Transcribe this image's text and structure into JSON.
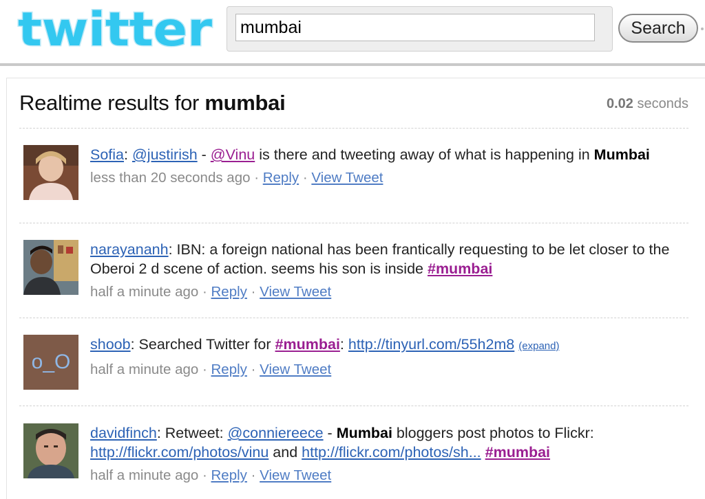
{
  "header": {
    "logo_text": "twitter",
    "search_value": "mumbai",
    "search_button": "Search"
  },
  "results": {
    "heading_prefix": "Realtime results for ",
    "query": "mumbai",
    "time_value": "0.02",
    "time_unit": " seconds"
  },
  "tweets": [
    {
      "user": "Sofia",
      "mention1": "@justirish",
      "sep": " - ",
      "mention2": "@Vinu",
      "text": " is there and tweeting away of what is happening in ",
      "bold": "Mumbai",
      "time": "less than 20 seconds ago",
      "reply": "Reply",
      "view": "View Tweet"
    },
    {
      "user": "narayananh",
      "text": "IBN: a foreign national has been frantically requesting to be let closer to the Oberoi 2 d scene of action. seems his son is inside ",
      "tag": "#mumbai",
      "time": "half a minute ago",
      "reply": "Reply",
      "view": "View Tweet"
    },
    {
      "user": "shoob",
      "text": "Searched Twitter for ",
      "tag": "#mumbai",
      "colon": ": ",
      "link": "http://tinyurl.com/55h2m8",
      "expand": "(expand)",
      "avatar_text": "o_O",
      "time": "half a minute ago",
      "reply": "Reply",
      "view": "View Tweet"
    },
    {
      "user": "davidfinch",
      "text1": "Retweet: ",
      "mention": "@conniereece",
      "sep": " - ",
      "bold": "Mumbai",
      "text2": " bloggers post photos to Flickr: ",
      "link1": "http://flickr.com/photos/vinu",
      "and": " and ",
      "link2": "http://flickr.com/photos/sh...",
      "tag": "#mumbai",
      "time": "half a minute ago",
      "reply": "Reply",
      "view": "View Tweet"
    }
  ],
  "colors": {
    "logo": "#33c8f0",
    "link": "#2c62b5",
    "hashtag": "#9a1e91",
    "meta": "#8a8a8a"
  }
}
